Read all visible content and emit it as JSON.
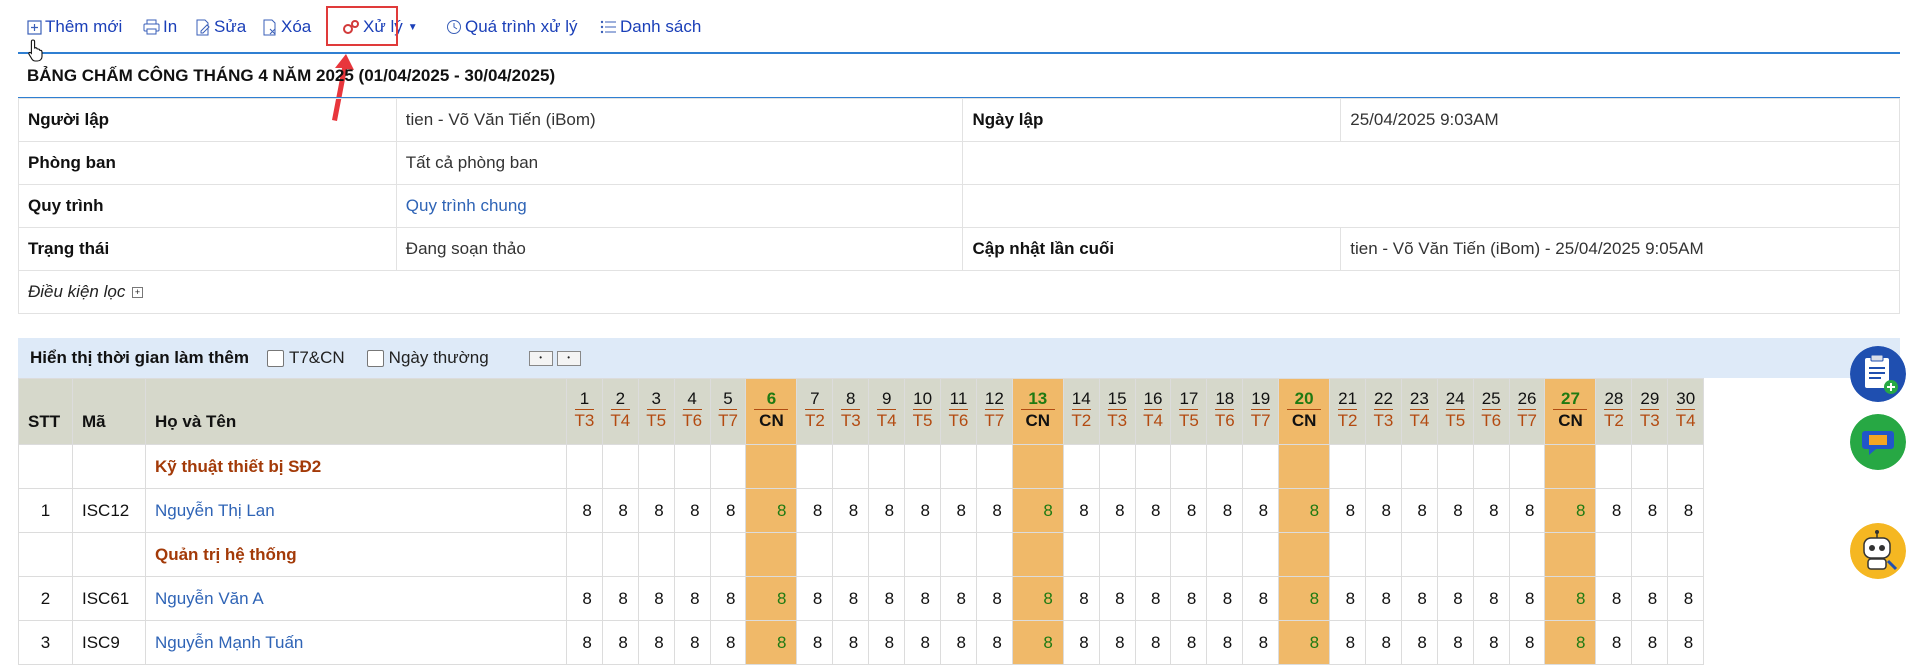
{
  "toolbar": {
    "add_label": "Thêm mới",
    "print_label": "In",
    "edit_label": "Sửa",
    "delete_label": "Xóa",
    "process_label": "Xử lý",
    "history_label": "Quá trình xử lý",
    "list_label": "Danh sách"
  },
  "title": "BẢNG CHẤM CÔNG THÁNG 4 NĂM 2025 (01/04/2025 - 30/04/2025)",
  "info": {
    "creator_label": "Người lập",
    "creator_value": "tien - Võ Văn Tiến (iBom)",
    "date_label": "Ngày lập",
    "date_value": "25/04/2025 9:03AM",
    "dept_label": "Phòng ban",
    "dept_value": "Tất cả phòng ban",
    "process_label": "Quy trình",
    "process_value": "Quy trình chung",
    "status_label": "Trạng thái",
    "status_value": "Đang soạn thảo",
    "updated_label": "Cập nhật lần cuối",
    "updated_value": "tien - Võ Văn Tiến (iBom) - 25/04/2025 9:05AM",
    "filter_label": "Điều kiện lọc"
  },
  "overtime": {
    "label": "Hiển thị thời gian làm thêm",
    "weekend_label": "T7&CN",
    "weekday_label": "Ngày thường"
  },
  "grid": {
    "col_stt": "STT",
    "col_code": "Mã",
    "col_name": "Họ và Tên",
    "days": [
      {
        "d": "1",
        "w": "T3"
      },
      {
        "d": "2",
        "w": "T4"
      },
      {
        "d": "3",
        "w": "T5"
      },
      {
        "d": "4",
        "w": "T6"
      },
      {
        "d": "5",
        "w": "T7"
      },
      {
        "d": "6",
        "w": "CN",
        "sun": true
      },
      {
        "d": "7",
        "w": "T2"
      },
      {
        "d": "8",
        "w": "T3"
      },
      {
        "d": "9",
        "w": "T4"
      },
      {
        "d": "10",
        "w": "T5"
      },
      {
        "d": "11",
        "w": "T6"
      },
      {
        "d": "12",
        "w": "T7"
      },
      {
        "d": "13",
        "w": "CN",
        "sun": true
      },
      {
        "d": "14",
        "w": "T2"
      },
      {
        "d": "15",
        "w": "T3"
      },
      {
        "d": "16",
        "w": "T4"
      },
      {
        "d": "17",
        "w": "T5"
      },
      {
        "d": "18",
        "w": "T6"
      },
      {
        "d": "19",
        "w": "T7"
      },
      {
        "d": "20",
        "w": "CN",
        "sun": true
      },
      {
        "d": "21",
        "w": "T2"
      },
      {
        "d": "22",
        "w": "T3"
      },
      {
        "d": "23",
        "w": "T4"
      },
      {
        "d": "24",
        "w": "T5"
      },
      {
        "d": "25",
        "w": "T6"
      },
      {
        "d": "26",
        "w": "T7"
      },
      {
        "d": "27",
        "w": "CN",
        "sun": true
      },
      {
        "d": "28",
        "w": "T2"
      },
      {
        "d": "29",
        "w": "T3"
      },
      {
        "d": "30",
        "w": "T4"
      }
    ],
    "rows": [
      {
        "type": "group",
        "name": "Kỹ thuật thiết bị SĐ2"
      },
      {
        "type": "emp",
        "stt": "1",
        "code": "ISC12",
        "name": "Nguyễn Thị Lan",
        "hours": [
          "8",
          "8",
          "8",
          "8",
          "8",
          "8",
          "8",
          "8",
          "8",
          "8",
          "8",
          "8",
          "8",
          "8",
          "8",
          "8",
          "8",
          "8",
          "8",
          "8",
          "8",
          "8",
          "8",
          "8",
          "8",
          "8",
          "8",
          "8",
          "8",
          "8"
        ]
      },
      {
        "type": "group",
        "name": "Quản trị hệ thống"
      },
      {
        "type": "emp",
        "stt": "2",
        "code": "ISC61",
        "name": "Nguyễn Văn A",
        "hours": [
          "8",
          "8",
          "8",
          "8",
          "8",
          "8",
          "8",
          "8",
          "8",
          "8",
          "8",
          "8",
          "8",
          "8",
          "8",
          "8",
          "8",
          "8",
          "8",
          "8",
          "8",
          "8",
          "8",
          "8",
          "8",
          "8",
          "8",
          "8",
          "8",
          "8"
        ]
      },
      {
        "type": "emp",
        "stt": "3",
        "code": "ISC9",
        "name": "Nguyễn Mạnh Tuấn",
        "hours": [
          "8",
          "8",
          "8",
          "8",
          "8",
          "8",
          "8",
          "8",
          "8",
          "8",
          "8",
          "8",
          "8",
          "8",
          "8",
          "8",
          "8",
          "8",
          "8",
          "8",
          "8",
          "8",
          "8",
          "8",
          "8",
          "8",
          "8",
          "8",
          "8",
          "8"
        ]
      }
    ]
  },
  "colors": {
    "accent_blue": "#2f7fd2",
    "link_blue": "#1a3fb8",
    "sunday_orange": "#f0b969",
    "header_gray": "#d6d8cb",
    "highlight_red": "#e03a3a"
  }
}
